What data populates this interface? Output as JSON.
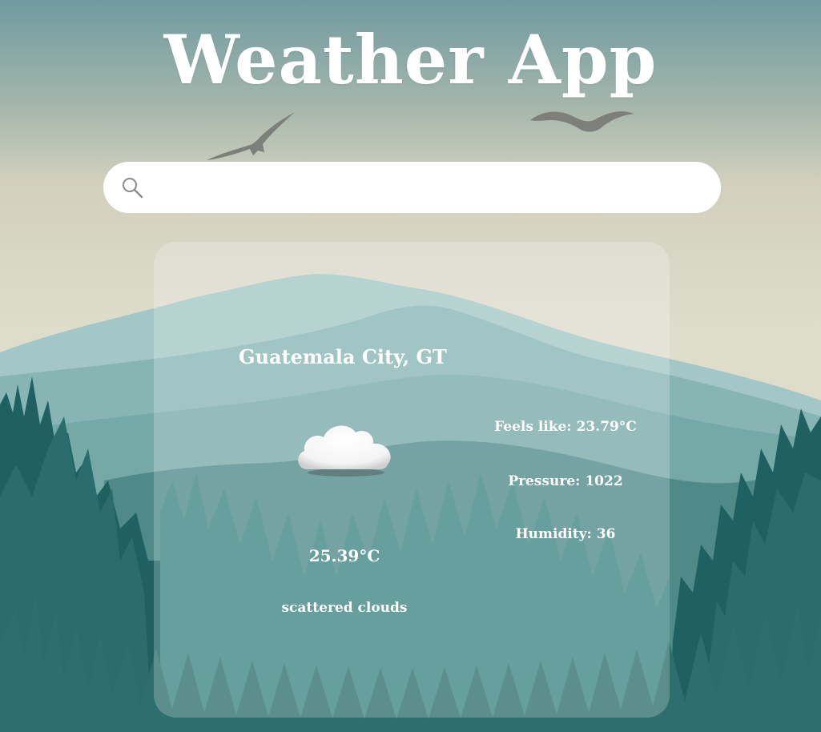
{
  "app": {
    "title": "Weather App"
  },
  "search": {
    "placeholder": "",
    "value": "",
    "icon": "search-icon"
  },
  "weather": {
    "city": "Guatemala City, GT",
    "icon": "cloud-icon",
    "temperature": "25.39°C",
    "description": "scattered clouds",
    "feels_like_label": "Feels like: ",
    "feels_like_value": "23.79°C",
    "pressure_label": "Pressure: ",
    "pressure_value": "1022",
    "humidity_label": "Humidity: ",
    "humidity_value": "36"
  },
  "colors": {
    "sky_top": "#6f9ba0",
    "sky_bottom": "#dcd9c6",
    "mountain_light": "#9fc4c4",
    "mountain_mid": "#7fb0b0",
    "forest_dark": "#1f5e5e",
    "forest_mid": "#3f8585",
    "text": "#ffffff"
  }
}
